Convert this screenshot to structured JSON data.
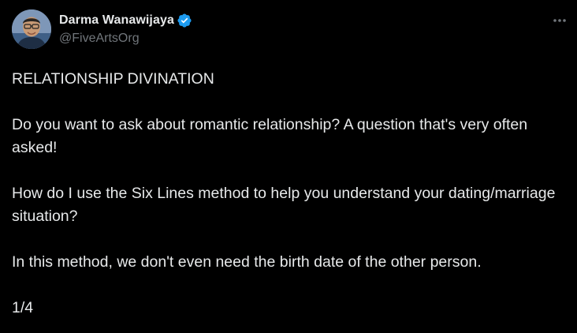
{
  "author": {
    "display_name": "Darma Wanawijaya",
    "handle": "@FiveArtsOrg",
    "verified": true,
    "avatar_icon": "profile-photo-avatar"
  },
  "menu": {
    "icon": "more-horizontal-icon"
  },
  "tweet": {
    "paragraphs": [
      "RELATIONSHIP DIVINATION",
      "Do you want to ask about romantic relationship?  A question that's very often asked!",
      "How do I use the Six Lines method to help you understand your dating/marriage situation?",
      "In this method, we don't even need the birth date of the other person.",
      "1/4"
    ]
  },
  "colors": {
    "background": "#000000",
    "text": "#e7e9ea",
    "secondary_text": "#71767b",
    "verified_badge": "#1d9bf0"
  }
}
